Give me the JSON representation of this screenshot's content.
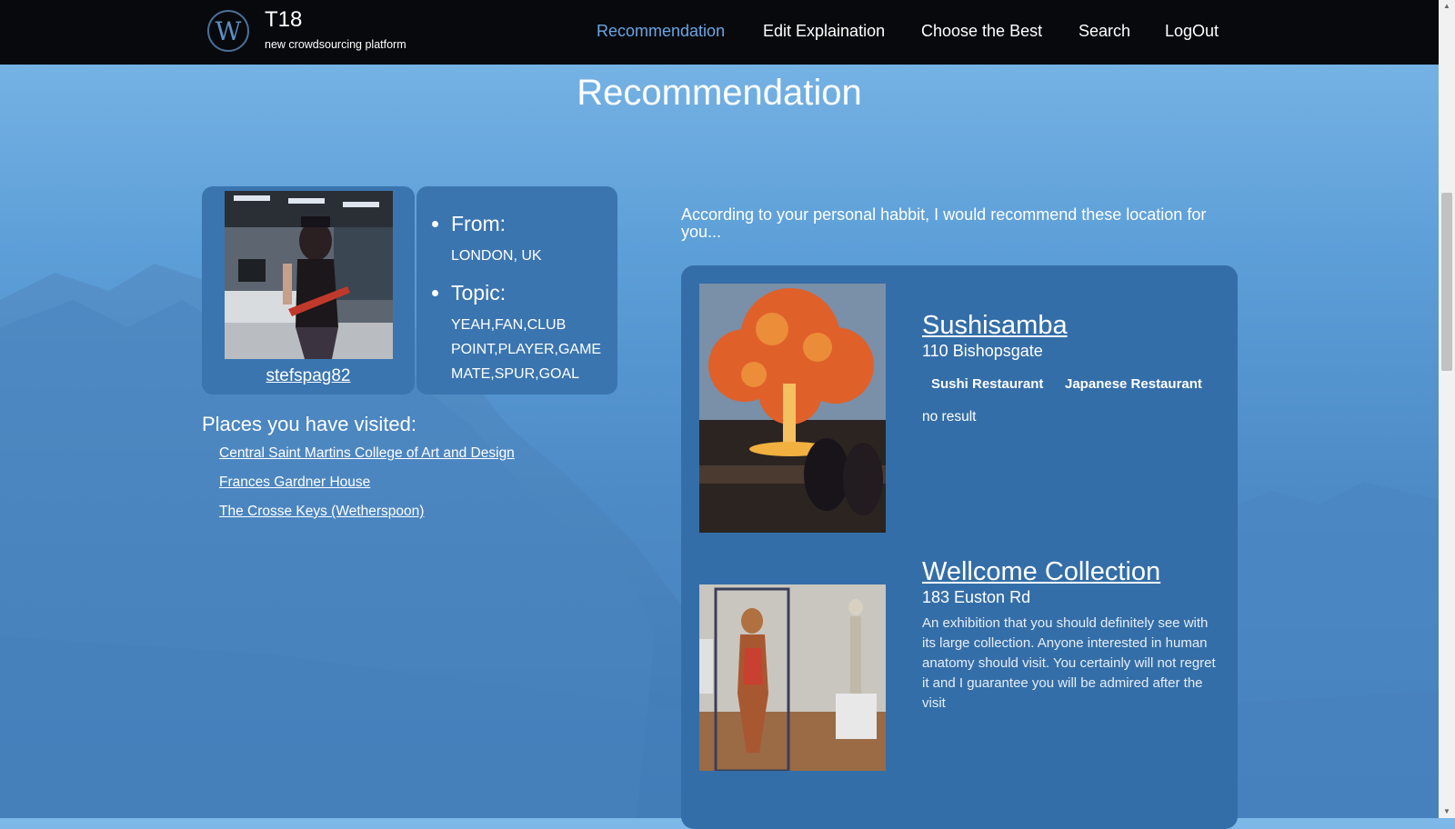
{
  "nav": {
    "logo_letter": "W",
    "brand_title": "T18",
    "brand_subtitle": "new crowdsourcing platform",
    "links": [
      "Recommendation",
      "Edit Explaination",
      "Choose the Best",
      "Search",
      "LogOut"
    ],
    "active_link": "Recommendation"
  },
  "page": {
    "title": "Recommendation"
  },
  "profile": {
    "username": "stefspag82",
    "from_label": "From:",
    "from_value": "LONDON, UK",
    "topic_label": "Topic:",
    "topic_lines": [
      "YEAH,FAN,CLUB",
      "POINT,PLAYER,GAME",
      "MATE,SPUR,GOAL"
    ]
  },
  "visited": {
    "heading": "Places you have visited:",
    "places": [
      "Central Saint Martins College of Art and Design",
      "Frances Gardner House",
      "The Crosse Keys (Wetherspoon)"
    ]
  },
  "recommendations": {
    "intro": "According to your personal habbit, I would recommend these location for you...",
    "items": [
      {
        "name": "Sushisamba",
        "address": "110 Bishopsgate",
        "tags": [
          "Sushi Restaurant",
          "Japanese Restaurant"
        ],
        "result": "no result"
      },
      {
        "name": "Wellcome Collection",
        "address": "183 Euston Rd",
        "description": "An exhibition that you should definitely see with its large collection. Anyone interested in human anatomy should visit. You certainly will not regret it and I guarantee you will be admired after the visit"
      }
    ]
  },
  "colors": {
    "nav_bg": "#07090c",
    "active_link": "#6aa6e6",
    "card_bg": "#3a75b0",
    "panel_bg": "#346ea8"
  }
}
